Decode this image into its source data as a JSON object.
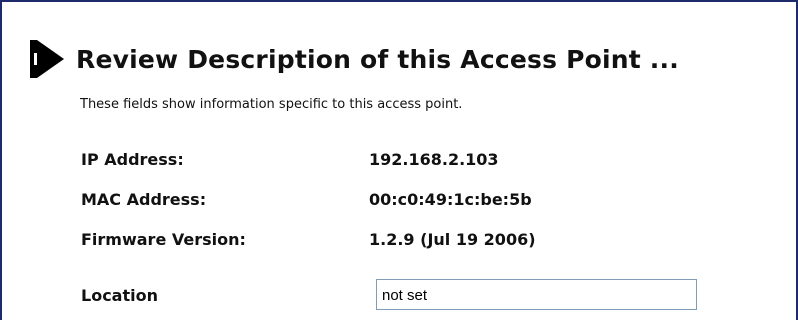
{
  "section": {
    "title": "Review Description of this Access Point ...",
    "title_icon": "right-arrow-bullet-icon",
    "intro": "These fields show information specific to this access point."
  },
  "fields": {
    "ip_address": {
      "label": "IP Address:",
      "value": "192.168.2.103"
    },
    "mac_address": {
      "label": "MAC Address:",
      "value": "00:c0:49:1c:be:5b"
    },
    "firmware_version": {
      "label": "Firmware Version:",
      "value": "1.2.9 (Jul 19 2006)"
    },
    "location": {
      "label": "Location",
      "value": "not set"
    }
  },
  "colors": {
    "frame_border": "#1f2a6b",
    "text": "#111111",
    "input_border": "#7f9db9"
  }
}
